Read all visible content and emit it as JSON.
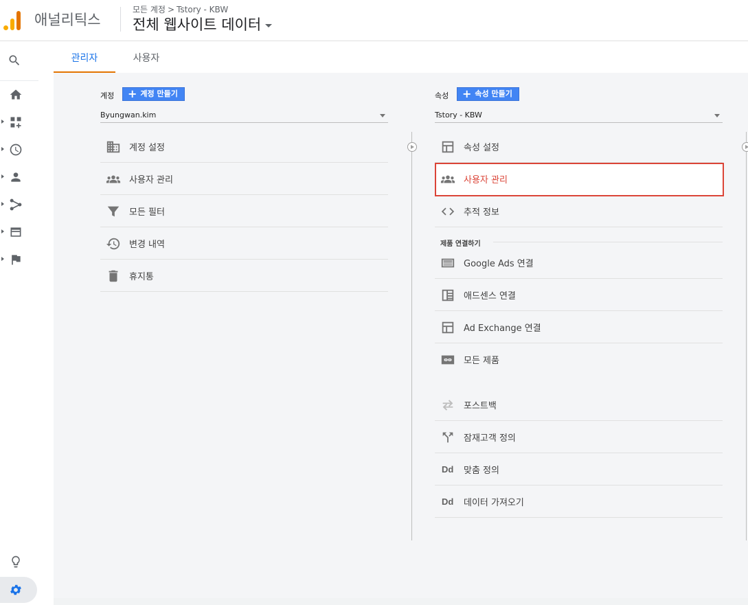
{
  "header": {
    "app_name": "애널리틱스",
    "breadcrumb_account": "모든 계정",
    "breadcrumb_sep": ">",
    "breadcrumb_property": "Tstory - KBW",
    "view_title": "전체 웹사이트 데이터"
  },
  "tabs": [
    {
      "label": "관리자",
      "active": true
    },
    {
      "label": "사용자",
      "active": false
    }
  ],
  "account": {
    "label": "계정",
    "create_label": "계정 만들기",
    "selected": "Byungwan.kim",
    "items": [
      {
        "label": "계정 설정",
        "icon": "building-icon"
      },
      {
        "label": "사용자 관리",
        "icon": "people-icon"
      },
      {
        "label": "모든 필터",
        "icon": "filter-icon"
      },
      {
        "label": "변경 내역",
        "icon": "history-icon"
      },
      {
        "label": "휴지통",
        "icon": "trash-icon"
      }
    ]
  },
  "property": {
    "label": "속성",
    "create_label": "속성 만들기",
    "selected": "Tstory - KBW",
    "items": [
      {
        "label": "속성 설정",
        "icon": "window-icon"
      },
      {
        "label": "사용자 관리",
        "icon": "people-icon",
        "selected": true
      },
      {
        "label": "추적 정보",
        "icon": "code-icon"
      }
    ],
    "section_title": "제품 연결하기",
    "linking": [
      {
        "label": "Google Ads 연결",
        "icon": "ads-icon"
      },
      {
        "label": "애드센스 연결",
        "icon": "adsense-icon"
      },
      {
        "label": "Ad Exchange 연결",
        "icon": "window-icon"
      },
      {
        "label": "모든 제품",
        "icon": "link-icon"
      }
    ],
    "other": [
      {
        "label": "포스트백",
        "icon": "postback-icon"
      },
      {
        "label": "잠재고객 정의",
        "icon": "fork-icon"
      },
      {
        "label": "맞춤 정의",
        "icon": "dd-icon",
        "icon_text": "Dd"
      },
      {
        "label": "데이터 가져오기",
        "icon": "dd-icon",
        "icon_text": "Dd"
      }
    ]
  },
  "colors": {
    "accent": "#1a73e8",
    "tab_indicator": "#e37400",
    "button": "#4285f4",
    "selected_border": "#db4437"
  }
}
